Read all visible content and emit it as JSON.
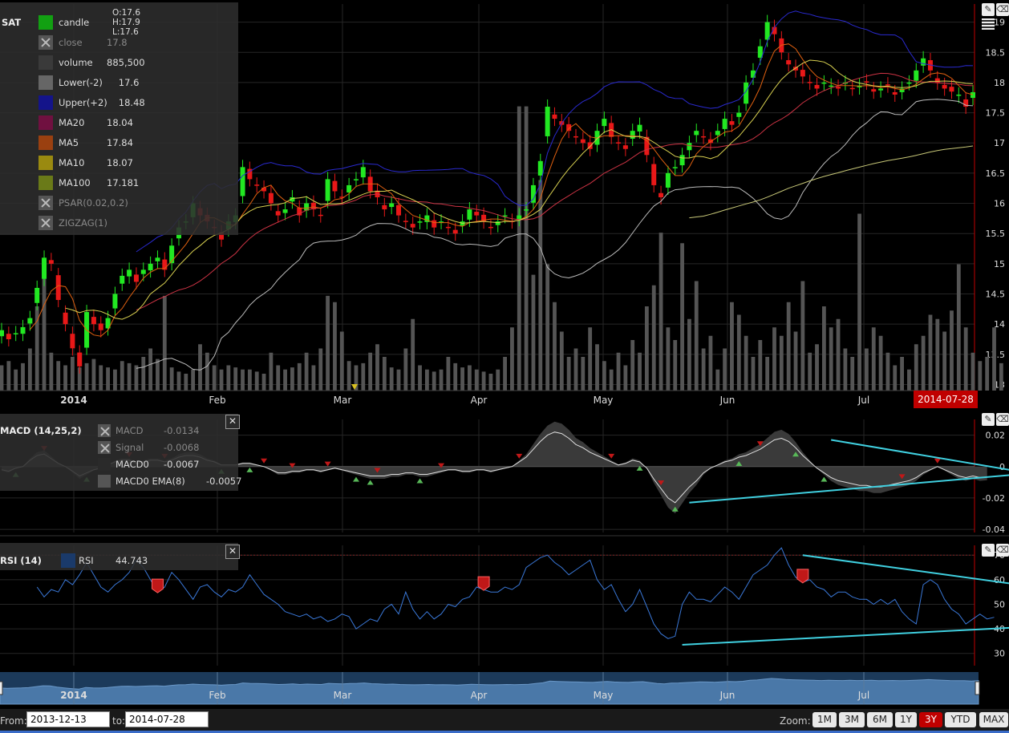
{
  "colors": {
    "up": "#22e822",
    "down": "#e81818",
    "upper": "#2222aa",
    "lower": "#bbbbbb",
    "ma20": "#cc3344",
    "ma5": "#e06010",
    "ma10": "#d8d050",
    "ma100": "#c8c878",
    "volume": "#555555",
    "macd": "#dddddd",
    "macd_hist": "#3a3a3a",
    "rsi": "#3a78d8",
    "trend": "#40d0e0",
    "marker_red": "#c01818",
    "marker_green": "#58b858"
  },
  "main_legend": {
    "symbol": "SAT",
    "ohlc": {
      "o": "O:17.6",
      "h": "H:17.9",
      "l": "L:17.6"
    },
    "items": [
      {
        "name": "candle",
        "value": "",
        "color": "#12a012",
        "on": true
      },
      {
        "name": "close",
        "value": "17.8",
        "color": "#555",
        "on": false
      },
      {
        "name": "volume",
        "value": "885,500",
        "color": "#3a3a3a",
        "on": true
      },
      {
        "name": "Lower(-2)",
        "value": "17.6",
        "color": "#666",
        "on": true
      },
      {
        "name": "Upper(+2)",
        "value": "18.48",
        "color": "#14148a",
        "on": true
      },
      {
        "name": "MA20",
        "value": "18.04",
        "color": "#701040",
        "on": true
      },
      {
        "name": "MA5",
        "value": "17.84",
        "color": "#9a4010",
        "on": true
      },
      {
        "name": "MA10",
        "value": "18.07",
        "color": "#9a8a10",
        "on": true
      },
      {
        "name": "MA100",
        "value": "17.181",
        "color": "#6a7a18",
        "on": true
      },
      {
        "name": "PSAR(0.02,0.2)",
        "value": "",
        "color": "#555",
        "on": false
      },
      {
        "name": "ZIGZAG(1)",
        "value": "",
        "color": "#555",
        "on": false
      }
    ]
  },
  "macd_legend": {
    "title": "MACD (14,25,2)",
    "items": [
      {
        "name": "MACD",
        "value": "-0.0134",
        "color": "#555",
        "on": false
      },
      {
        "name": "Signal",
        "value": "-0.0068",
        "color": "#555",
        "on": false
      },
      {
        "name": "MACD0",
        "value": "-0.0067",
        "color": "#2a2a2a",
        "on": true
      },
      {
        "name": "MACD0 EMA(8)",
        "value": "-0.0057",
        "color": "#555",
        "on": true
      }
    ]
  },
  "rsi_legend": {
    "title": "RSI (14)",
    "name": "RSI",
    "value": "44.743",
    "color": "#1a3a6a"
  },
  "close_glyph": "✕",
  "tool_icons": {
    "pencil": "✎",
    "eraser": "⌫"
  },
  "range": {
    "from_label": "From:",
    "from": "2013-12-13",
    "to_label": "to:",
    "to": "2014-07-28"
  },
  "zoom": {
    "label": "Zoom:",
    "buttons": [
      "1M",
      "3M",
      "6M",
      "1Y",
      "3Y",
      "YTD",
      "MAX"
    ],
    "active": "3Y"
  },
  "cursor_date": "2014-07-28",
  "chart_data": [
    {
      "type": "candlestick",
      "x_tick_labels": [
        "2014",
        "Feb",
        "Mar",
        "Apr",
        "May",
        "Jun",
        "Jul"
      ],
      "y_ticks": [
        13,
        13.5,
        14,
        14.5,
        15,
        15.5,
        16,
        16.5,
        17,
        17.5,
        18,
        18.5,
        19
      ],
      "ylim": [
        12.9,
        19.3
      ],
      "grid": true,
      "close": [
        13.9,
        13.75,
        13.85,
        13.95,
        14.1,
        14.6,
        15.1,
        15.0,
        14.4,
        14.0,
        13.6,
        13.3,
        14.2,
        14.0,
        13.9,
        14.1,
        14.5,
        14.8,
        14.9,
        14.7,
        14.9,
        15.0,
        15.1,
        14.9,
        15.3,
        15.6,
        15.7,
        16.0,
        15.8,
        15.7,
        15.6,
        15.4,
        15.7,
        15.8,
        16.6,
        16.4,
        16.3,
        16.2,
        16.0,
        15.8,
        15.9,
        16.1,
        15.8,
        16.0,
        15.9,
        15.8,
        16.4,
        16.2,
        16.1,
        16.3,
        16.4,
        16.6,
        16.2,
        16.1,
        15.9,
        16.0,
        15.8,
        15.7,
        15.6,
        15.7,
        15.8,
        15.6,
        15.7,
        15.6,
        15.5,
        15.7,
        15.9,
        15.8,
        15.7,
        15.6,
        15.7,
        15.8,
        15.7,
        15.8,
        15.9,
        16.3,
        16.7,
        17.6,
        17.4,
        17.3,
        17.2,
        17.1,
        17.0,
        16.9,
        17.2,
        17.4,
        17.1,
        17.0,
        16.9,
        17.2,
        17.3,
        16.8,
        16.3,
        16.1,
        16.5,
        16.6,
        16.8,
        17.0,
        17.2,
        17.1,
        17.0,
        17.2,
        17.4,
        17.3,
        17.5,
        18.0,
        18.2,
        18.6,
        19.0,
        18.8,
        18.5,
        18.3,
        18.2,
        18.1,
        18.0,
        17.9,
        18.0,
        17.95,
        17.9,
        18.0,
        17.9,
        17.95,
        18.0,
        17.85,
        17.9,
        17.95,
        17.8,
        17.9,
        18.0,
        18.2,
        18.4,
        18.2,
        18.0,
        17.9,
        17.85,
        17.8,
        17.6,
        17.84
      ],
      "volume_max": 1600000,
      "volume": [
        120000,
        140000,
        100000,
        130000,
        200000,
        400000,
        600000,
        180000,
        140000,
        120000,
        160000,
        110000,
        130000,
        150000,
        120000,
        110000,
        100000,
        140000,
        130000,
        120000,
        160000,
        200000,
        150000,
        450000,
        110000,
        90000,
        80000,
        100000,
        220000,
        180000,
        120000,
        100000,
        120000,
        110000,
        100000,
        100000,
        90000,
        80000,
        180000,
        120000,
        100000,
        110000,
        130000,
        180000,
        120000,
        200000,
        450000,
        420000,
        280000,
        140000,
        120000,
        130000,
        180000,
        220000,
        160000,
        110000,
        100000,
        200000,
        340000,
        120000,
        100000,
        90000,
        100000,
        160000,
        130000,
        110000,
        120000,
        100000,
        90000,
        80000,
        100000,
        160000,
        300000,
        1350000,
        1350000,
        550000,
        1000000,
        600000,
        420000,
        280000,
        160000,
        200000,
        160000,
        300000,
        220000,
        140000,
        100000,
        180000,
        120000,
        240000,
        180000,
        400000,
        500000,
        750000,
        300000,
        240000,
        700000,
        340000,
        520000,
        200000,
        260000,
        100000,
        200000,
        420000,
        360000,
        260000,
        160000,
        240000,
        160000,
        300000,
        260000,
        420000,
        280000,
        520000,
        180000,
        220000,
        400000,
        300000,
        340000,
        200000,
        160000,
        840000,
        200000,
        300000,
        260000,
        180000,
        120000,
        160000,
        100000,
        220000,
        260000,
        360000,
        340000,
        280000,
        380000,
        600000,
        300000,
        180000,
        140000,
        160000,
        300000,
        130000
      ]
    },
    {
      "type": "line",
      "x_tick_labels": [
        "2014",
        "Feb",
        "Mar",
        "Apr",
        "May",
        "Jun",
        "Jul"
      ],
      "y_ticks": [
        0.02,
        0,
        -0.02,
        -0.04
      ],
      "ylim": [
        -0.042,
        0.03
      ],
      "macd0": [
        -0.002,
        -0.003,
        -0.001,
        0.0,
        0.004,
        0.007,
        0.008,
        0.005,
        0.002,
        0.0,
        -0.003,
        -0.006,
        -0.004,
        -0.002,
        -0.001,
        0.001,
        0.003,
        0.004,
        0.004,
        0.002,
        0.003,
        0.004,
        0.004,
        0.003,
        0.004,
        0.006,
        0.007,
        0.007,
        0.006,
        0.004,
        0.003,
        0.001,
        0.001,
        0.001,
        0.002,
        0.002,
        0.001,
        0.0,
        -0.002,
        -0.004,
        -0.004,
        -0.003,
        -0.003,
        -0.002,
        -0.002,
        -0.003,
        -0.002,
        -0.001,
        -0.002,
        -0.003,
        -0.004,
        -0.005,
        -0.006,
        -0.006,
        -0.006,
        -0.005,
        -0.005,
        -0.004,
        -0.004,
        -0.005,
        -0.005,
        -0.004,
        -0.003,
        -0.002,
        -0.002,
        -0.003,
        -0.003,
        -0.002,
        -0.002,
        -0.003,
        -0.002,
        -0.001,
        0.0,
        0.003,
        0.006,
        0.011,
        0.016,
        0.02,
        0.022,
        0.021,
        0.018,
        0.014,
        0.012,
        0.009,
        0.007,
        0.005,
        0.003,
        0.001,
        0.002,
        0.004,
        0.003,
        -0.001,
        -0.008,
        -0.014,
        -0.02,
        -0.023,
        -0.018,
        -0.013,
        -0.009,
        -0.004,
        -0.001,
        0.001,
        0.003,
        0.004,
        0.006,
        0.007,
        0.009,
        0.011,
        0.014,
        0.017,
        0.018,
        0.016,
        0.012,
        0.007,
        0.003,
        -0.001,
        -0.004,
        -0.007,
        -0.009,
        -0.01,
        -0.011,
        -0.012,
        -0.012,
        -0.013,
        -0.013,
        -0.012,
        -0.011,
        -0.01,
        -0.009,
        -0.007,
        -0.004,
        -0.002,
        0.0,
        -0.002,
        -0.004,
        -0.006,
        -0.007,
        -0.006,
        -0.007,
        -0.0067
      ],
      "down_markers": [
        6,
        18,
        23,
        37,
        41,
        46,
        53,
        62,
        73,
        86,
        93,
        107,
        127,
        132
      ],
      "up_markers": [
        2,
        12,
        31,
        35,
        50,
        52,
        59,
        90,
        95,
        104,
        112,
        116
      ],
      "trendlines": [
        {
          "from": [
            97,
            -0.023
          ],
          "to": [
            146,
            -0.004
          ]
        },
        {
          "from": [
            117,
            0.017
          ],
          "to": [
            146,
            -0.005
          ]
        }
      ]
    },
    {
      "type": "line",
      "x_tick_labels": [
        "2014",
        "Feb",
        "Mar",
        "Apr",
        "May",
        "Jun",
        "Jul"
      ],
      "y_ticks": [
        30,
        40,
        50,
        60,
        70
      ],
      "ylim": [
        25,
        74
      ],
      "reference_level": 70,
      "rsi": [
        50,
        50,
        46,
        52,
        55,
        57,
        53,
        56,
        55,
        60,
        58,
        62,
        67,
        62,
        57,
        55,
        58,
        60,
        63,
        68,
        65,
        60,
        55,
        57,
        63,
        60,
        56,
        52,
        57,
        58,
        55,
        53,
        56,
        55,
        57,
        62,
        58,
        54,
        52,
        50,
        47,
        46,
        45,
        46,
        44,
        45,
        43,
        44,
        46,
        45,
        40,
        42,
        44,
        43,
        48,
        50,
        46,
        55,
        48,
        44,
        47,
        44,
        46,
        50,
        49,
        52,
        53,
        57,
        56,
        55,
        55,
        57,
        56,
        58,
        65,
        67,
        69,
        70,
        67,
        65,
        62,
        64,
        66,
        68,
        60,
        56,
        58,
        52,
        47,
        50,
        56,
        49,
        42,
        38,
        36,
        37,
        50,
        55,
        52,
        52,
        51,
        54,
        57,
        55,
        52,
        57,
        62,
        64,
        66,
        70,
        73,
        66,
        61,
        59,
        60,
        57,
        56,
        53,
        55,
        55,
        53,
        52,
        52,
        50,
        52,
        50,
        52,
        47,
        44,
        42,
        58,
        60,
        58,
        52,
        48,
        46,
        42,
        44,
        46,
        44,
        44.7
      ],
      "markers": [
        22,
        68,
        113
      ],
      "trendlines": [
        {
          "from": [
            96,
            33.5
          ],
          "to": [
            146,
            41
          ]
        },
        {
          "from": [
            113,
            70
          ],
          "to": [
            146,
            57
          ]
        }
      ]
    }
  ]
}
